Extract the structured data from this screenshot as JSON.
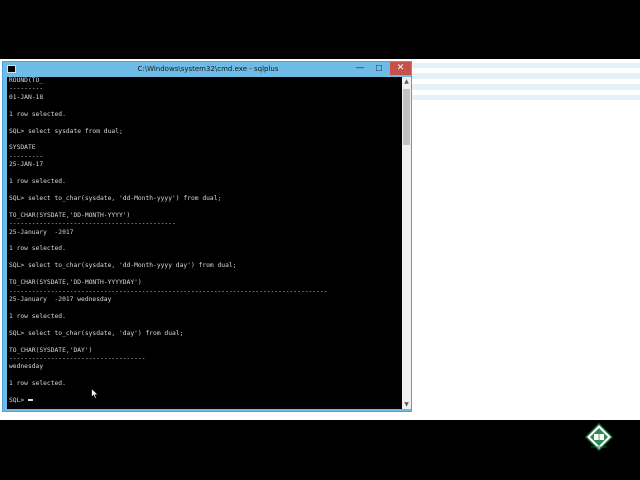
{
  "window": {
    "title": "C:\\Windows\\system32\\cmd.exe - sqlplus",
    "minimize_glyph": "—",
    "maximize_glyph": "☐",
    "close_glyph": "✕"
  },
  "console_lines": [
    "ROUND(TO_",
    "---------",
    "01-JAN-18",
    "",
    "1 row selected.",
    "",
    "SQL> select sysdate from dual;",
    "",
    "SYSDATE",
    "---------",
    "25-JAN-17",
    "",
    "1 row selected.",
    "",
    "SQL> select to_char(sysdate, 'dd-Month-yyyy') from dual;",
    "",
    "TO_CHAR(SYSDATE,'DD-MONTH-YYYY')",
    "--------------------------------------------",
    "25-January  -2017",
    "",
    "1 row selected.",
    "",
    "SQL> select to_char(sysdate, 'dd-Month-yyyy day') from dual;",
    "",
    "TO_CHAR(SYSDATE,'DD-MONTH-YYYYDAY')",
    "------------------------------------------------------------------------------------",
    "25-January  -2017 wednesday",
    "",
    "1 row selected.",
    "",
    "SQL> select to_char(sysdate, 'day') from dual;",
    "",
    "TO_CHAR(SYSDATE,'DAY')",
    "------------------------------------",
    "wednesday",
    "",
    "1 row selected.",
    "",
    "SQL> "
  ],
  "icons": {
    "app": "cmd-icon",
    "logo": "tutorial-logo-icon",
    "pointer": "mouse-pointer-icon"
  },
  "colors": {
    "titlebar": "#6dbbe6",
    "console_bg": "#000000",
    "console_text": "#d8d8d8",
    "close_button": "#c7504a",
    "desktop_band": "#e4f1f8"
  }
}
